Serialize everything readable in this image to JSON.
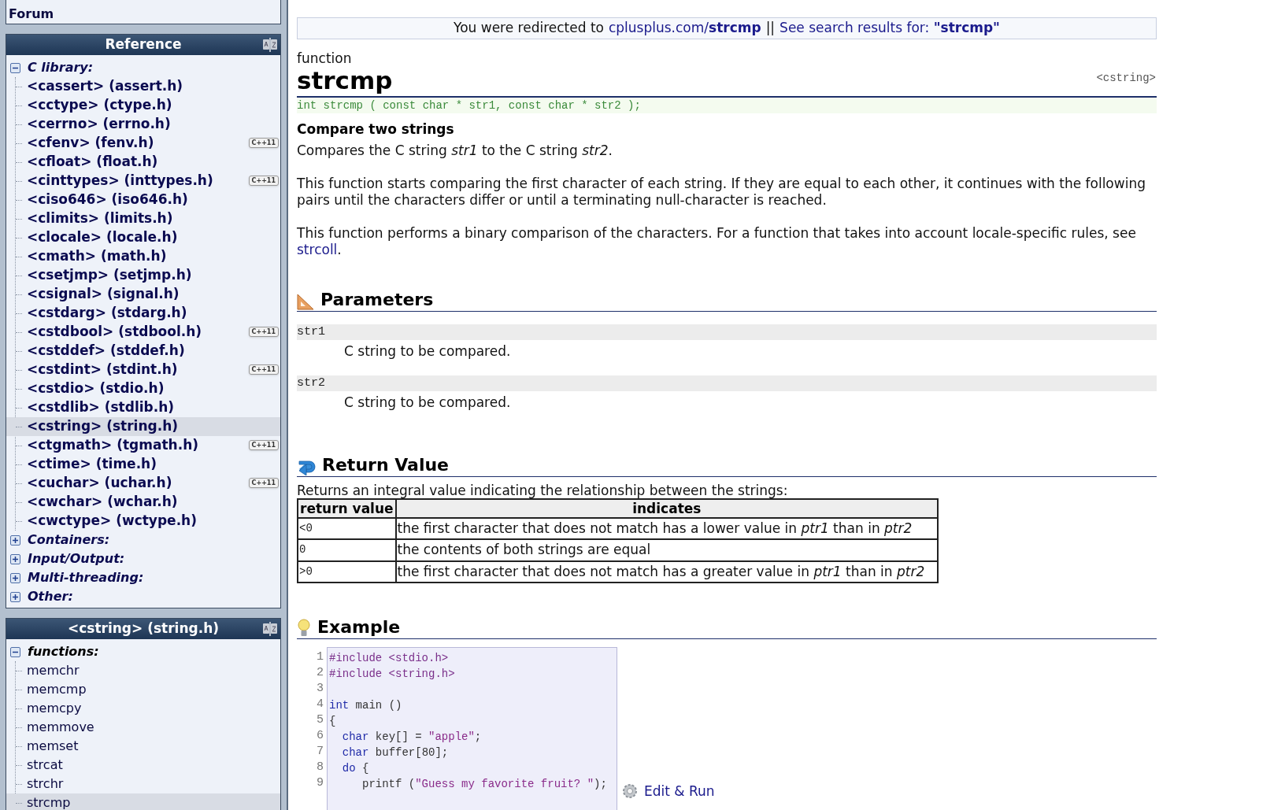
{
  "sidebar": {
    "top_links": [
      {
        "label": "Forum"
      }
    ],
    "panels": [
      {
        "kind": "headers",
        "title": "Reference",
        "groups": [
          {
            "label": "C library:",
            "expanded": true,
            "children": [
              {
                "label": "<cassert> (assert.h)",
                "selected": false
              },
              {
                "label": "<cctype> (ctype.h)",
                "selected": false
              },
              {
                "label": "<cerrno> (errno.h)",
                "selected": false
              },
              {
                "label": "<cfenv> (fenv.h)",
                "selected": false,
                "badge": "C++11"
              },
              {
                "label": "<cfloat> (float.h)",
                "selected": false
              },
              {
                "label": "<cinttypes> (inttypes.h)",
                "selected": false,
                "badge": "C++11"
              },
              {
                "label": "<ciso646> (iso646.h)",
                "selected": false
              },
              {
                "label": "<climits> (limits.h)",
                "selected": false
              },
              {
                "label": "<clocale> (locale.h)",
                "selected": false
              },
              {
                "label": "<cmath> (math.h)",
                "selected": false
              },
              {
                "label": "<csetjmp> (setjmp.h)",
                "selected": false
              },
              {
                "label": "<csignal> (signal.h)",
                "selected": false
              },
              {
                "label": "<cstdarg> (stdarg.h)",
                "selected": false
              },
              {
                "label": "<cstdbool> (stdbool.h)",
                "selected": false,
                "badge": "C++11"
              },
              {
                "label": "<cstddef> (stddef.h)",
                "selected": false
              },
              {
                "label": "<cstdint> (stdint.h)",
                "selected": false,
                "badge": "C++11"
              },
              {
                "label": "<cstdio> (stdio.h)",
                "selected": false
              },
              {
                "label": "<cstdlib> (stdlib.h)",
                "selected": false
              },
              {
                "label": "<cstring> (string.h)",
                "selected": true
              },
              {
                "label": "<ctgmath> (tgmath.h)",
                "selected": false,
                "badge": "C++11"
              },
              {
                "label": "<ctime> (time.h)",
                "selected": false
              },
              {
                "label": "<cuchar> (uchar.h)",
                "selected": false,
                "badge": "C++11"
              },
              {
                "label": "<cwchar> (wchar.h)",
                "selected": false
              },
              {
                "label": "<cwctype> (wctype.h)",
                "selected": false
              }
            ]
          },
          {
            "label": "Containers:",
            "expanded": false
          },
          {
            "label": "Input/Output:",
            "expanded": false
          },
          {
            "label": "Multi-threading:",
            "expanded": false
          },
          {
            "label": "Other:",
            "expanded": false
          }
        ]
      },
      {
        "kind": "members",
        "title": "<cstring> (string.h)",
        "groups": [
          {
            "label": "functions:",
            "expanded": true,
            "children": [
              {
                "label": "memchr",
                "selected": false
              },
              {
                "label": "memcmp",
                "selected": false
              },
              {
                "label": "memcpy",
                "selected": false
              },
              {
                "label": "memmove",
                "selected": false
              },
              {
                "label": "memset",
                "selected": false
              },
              {
                "label": "strcat",
                "selected": false
              },
              {
                "label": "strchr",
                "selected": false
              },
              {
                "label": "strcmp",
                "selected": true
              }
            ]
          }
        ]
      }
    ]
  },
  "redirect_notice": {
    "text": "You were redirected to",
    "redirect_link": "cplusplus.com/**strcmp**",
    "separator": "||",
    "search_link": "See search results for: **\"strcmp\"**"
  },
  "article": {
    "kind_label": "function",
    "name": "strcmp",
    "header": "<cstring>",
    "prototype": "int strcmp ( const char * str1, const char * str2 );",
    "summary": "Compare two strings",
    "paragraphs": [
      {
        "text": "Compares the C string *str1* to the C string *str2*."
      },
      {
        "text": "This function starts comparing the first character of each string. If they are equal to each other, it continues with the following pairs until the characters differ or until a terminating null-character is reached."
      },
      {
        "text": "This function performs a binary comparison of the characters. For a function that takes into account locale-specific rules, see",
        "link": "strcoll",
        "after": "."
      }
    ],
    "sections": [
      {
        "kind": "parameters",
        "title": "Parameters",
        "params": [
          {
            "name": "str1",
            "description": "C string to be compared."
          },
          {
            "name": "str2",
            "description": "C string to be compared."
          }
        ]
      },
      {
        "kind": "return",
        "title": "Return Value",
        "intro": "Returns an integral value indicating the relationship between the strings:",
        "table": {
          "columns": [
            "return value",
            "indicates"
          ],
          "rows": [
            [
              "<0",
              "the first character that does not match has a lower value in *ptr1* than in *ptr2*"
            ],
            [
              "0",
              "the contents of both strings are equal"
            ],
            [
              ">0",
              "the first character that does not match has a greater value in *ptr1* than in *ptr2*"
            ]
          ]
        }
      },
      {
        "kind": "example",
        "title": "Example",
        "edit_link": "Edit & Run",
        "lines": [
          {
            "number": "1",
            "tokens": [
              {
                "kind": "preprocessor",
                "text": "#include <stdio.h>"
              }
            ]
          },
          {
            "number": "2",
            "tokens": [
              {
                "kind": "preprocessor",
                "text": "#include <string.h>"
              }
            ]
          },
          {
            "number": "3"
          },
          {
            "number": "4",
            "tokens": [
              {
                "kind": "keyword",
                "text": "int"
              },
              {
                "kind": "plain",
                "text": " main ()"
              }
            ]
          },
          {
            "number": "5",
            "tokens": [
              {
                "kind": "plain",
                "text": "{"
              }
            ]
          },
          {
            "number": "6",
            "tokens": [
              {
                "kind": "keyword",
                "text": "  char"
              },
              {
                "kind": "plain",
                "text": " key[] = "
              },
              {
                "kind": "string",
                "text": "\"apple\""
              },
              {
                "kind": "plain",
                "text": ";"
              }
            ]
          },
          {
            "number": "7",
            "tokens": [
              {
                "kind": "keyword",
                "text": "  char"
              },
              {
                "kind": "plain",
                "text": " buffer[80];"
              }
            ]
          },
          {
            "number": "8",
            "tokens": [
              {
                "kind": "keyword",
                "text": "  do"
              },
              {
                "kind": "plain",
                "text": " {"
              }
            ]
          },
          {
            "number": "9",
            "tokens": [
              {
                "kind": "plain",
                "text": "     printf ("
              },
              {
                "kind": "string",
                "text": "\"Guess my favorite fruit? \""
              },
              {
                "kind": "plain",
                "text": ");"
              }
            ]
          }
        ]
      }
    ]
  }
}
